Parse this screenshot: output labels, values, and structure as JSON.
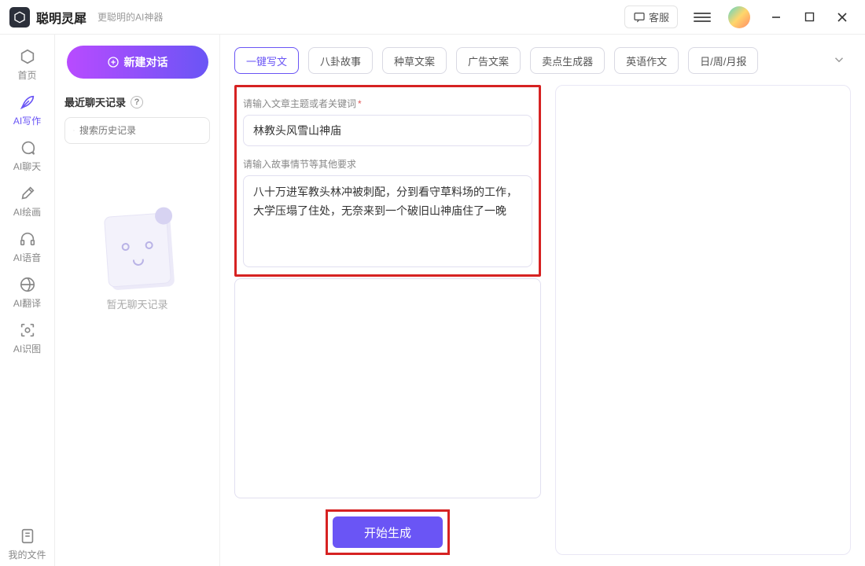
{
  "header": {
    "title": "聪明灵犀",
    "subtitle": "更聪明的AI神器",
    "kefu_label": "客服"
  },
  "nav": {
    "items": [
      {
        "label": "首页"
      },
      {
        "label": "AI写作"
      },
      {
        "label": "AI聊天"
      },
      {
        "label": "AI绘画"
      },
      {
        "label": "AI语音"
      },
      {
        "label": "AI翻译"
      },
      {
        "label": "AI识图"
      }
    ],
    "files_label": "我的文件"
  },
  "mid": {
    "new_chat": "新建对话",
    "recent_title": "最近聊天记录",
    "search_placeholder": "搜索历史记录",
    "empty_text": "暂无聊天记录"
  },
  "tabs": [
    "一键写文",
    "八卦故事",
    "种草文案",
    "广告文案",
    "卖点生成器",
    "英语作文",
    "日/周/月报"
  ],
  "form": {
    "topic_label": "请输入文章主题或者关键词",
    "topic_value": "林教头风雪山神庙",
    "detail_label": "请输入故事情节等其他要求",
    "detail_value": "八十万进军教头林冲被刺配，分到看守草料场的工作，大学压塌了住处，无奈来到一个破旧山神庙住了一晚",
    "generate": "开始生成"
  }
}
